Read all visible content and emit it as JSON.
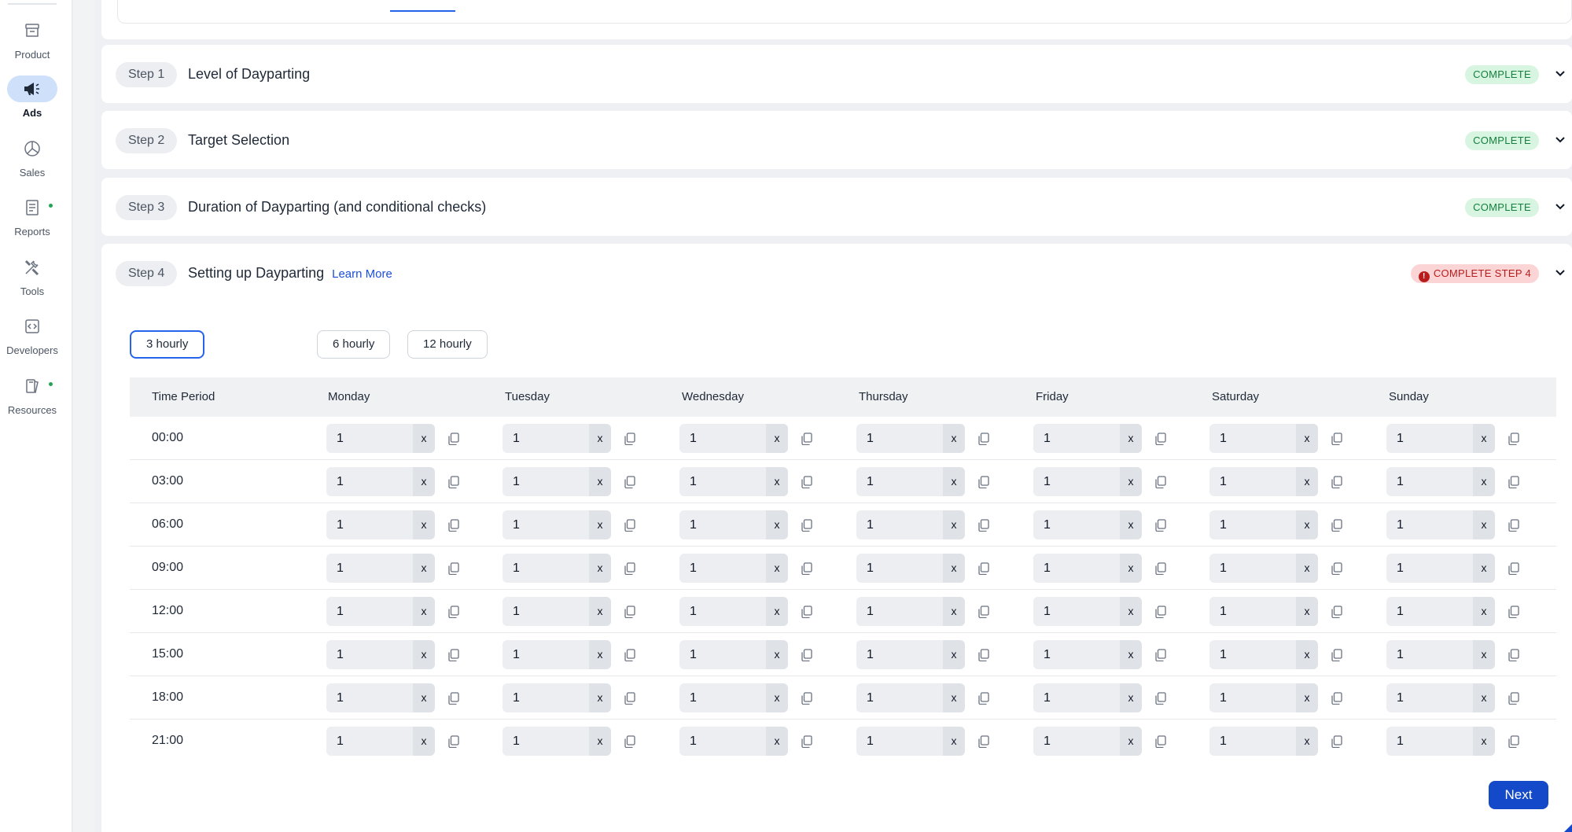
{
  "sidebar": {
    "items": [
      {
        "label": "Product",
        "icon": "archive-icon",
        "active": false,
        "dot": false
      },
      {
        "label": "Ads",
        "icon": "megaphone-icon",
        "active": true,
        "dot": false
      },
      {
        "label": "Sales",
        "icon": "pie-chart-icon",
        "active": false,
        "dot": false
      },
      {
        "label": "Reports",
        "icon": "document-icon",
        "active": false,
        "dot": true
      },
      {
        "label": "Tools",
        "icon": "tools-icon",
        "active": false,
        "dot": false
      },
      {
        "label": "Developers",
        "icon": "code-icon",
        "active": false,
        "dot": false
      },
      {
        "label": "Resources",
        "icon": "book-icon",
        "active": false,
        "dot": true
      }
    ]
  },
  "steps": [
    {
      "pill": "Step 1",
      "title": "Level of Dayparting",
      "status": "COMPLETE"
    },
    {
      "pill": "Step 2",
      "title": "Target Selection",
      "status": "COMPLETE"
    },
    {
      "pill": "Step 3",
      "title": "Duration of Dayparting (and conditional checks)",
      "status": "COMPLETE"
    },
    {
      "pill": "Step 4",
      "title": "Setting up Dayparting",
      "link": "Learn More",
      "status": "COMPLETE STEP 4"
    }
  ],
  "frequency": {
    "options": [
      "3 hourly",
      "6 hourly",
      "12 hourly"
    ],
    "selected": "3 hourly"
  },
  "table": {
    "headers": [
      "Time Period",
      "Monday",
      "Tuesday",
      "Wednesday",
      "Thursday",
      "Friday",
      "Saturday",
      "Sunday"
    ],
    "rows": [
      {
        "time": "00:00",
        "values": [
          "1",
          "1",
          "1",
          "1",
          "1",
          "1",
          "1"
        ]
      },
      {
        "time": "03:00",
        "values": [
          "1",
          "1",
          "1",
          "1",
          "1",
          "1",
          "1"
        ]
      },
      {
        "time": "06:00",
        "values": [
          "1",
          "1",
          "1",
          "1",
          "1",
          "1",
          "1"
        ]
      },
      {
        "time": "09:00",
        "values": [
          "1",
          "1",
          "1",
          "1",
          "1",
          "1",
          "1"
        ]
      },
      {
        "time": "12:00",
        "values": [
          "1",
          "1",
          "1",
          "1",
          "1",
          "1",
          "1"
        ]
      },
      {
        "time": "15:00",
        "values": [
          "1",
          "1",
          "1",
          "1",
          "1",
          "1",
          "1"
        ]
      },
      {
        "time": "18:00",
        "values": [
          "1",
          "1",
          "1",
          "1",
          "1",
          "1",
          "1"
        ]
      },
      {
        "time": "21:00",
        "values": [
          "1",
          "1",
          "1",
          "1",
          "1",
          "1",
          "1"
        ]
      }
    ],
    "clear_label": "x"
  },
  "actions": {
    "next_label": "Next"
  },
  "colors": {
    "accent": "#1449c9",
    "complete_bg": "#d8f5e2",
    "complete_text": "#15803d",
    "warn_bg": "#fbd5d5",
    "warn_text": "#b91c1c"
  }
}
